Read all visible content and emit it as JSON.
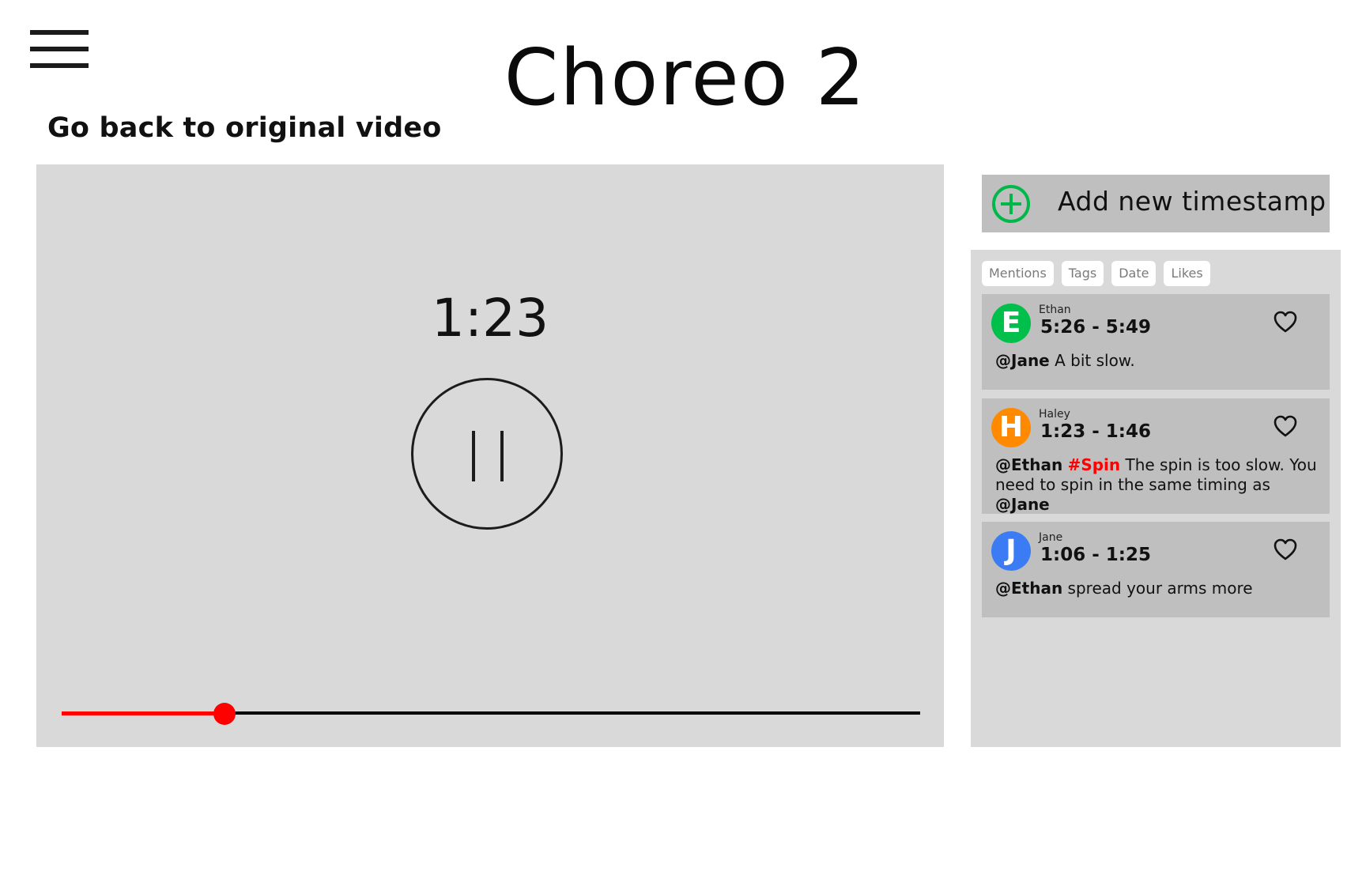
{
  "header": {
    "title": "Choreo 2",
    "back_link": "Go back to original video",
    "menu_icon": "hamburger-menu-icon"
  },
  "player": {
    "current_time": "1:23",
    "state": "playing",
    "control_icon": "pause-icon",
    "progress_fraction": 0.19,
    "colors": {
      "progress": "#ff0000",
      "track": "#000000",
      "background": "#d9d9d9"
    }
  },
  "timestamps": {
    "add_label": "Add new timestamp",
    "add_icon": "plus-circle-icon",
    "add_icon_color": "#00b84a",
    "filters": [
      "Mentions",
      "Tags",
      "Date",
      "Likes"
    ],
    "items": [
      {
        "author": "Ethan",
        "initial": "E",
        "avatar_color": "#00c04b",
        "start": "5:26",
        "end": "5:49",
        "comment": [
          {
            "type": "mention",
            "text": "@Jane"
          },
          {
            "type": "text",
            "text": " A bit slow."
          }
        ]
      },
      {
        "author": "Haley",
        "initial": "H",
        "avatar_color": "#ff8a00",
        "start": "1:23",
        "end": "1:46",
        "comment": [
          {
            "type": "mention",
            "text": "@Ethan"
          },
          {
            "type": "text",
            "text": " "
          },
          {
            "type": "tag",
            "text": "#Spin"
          },
          {
            "type": "text",
            "text": " The spin is too slow. You need to spin in the same timing as "
          },
          {
            "type": "mention",
            "text": "@Jane"
          }
        ]
      },
      {
        "author": "Jane",
        "initial": "J",
        "avatar_color": "#3b7cf5",
        "start": "1:06",
        "end": "1:25",
        "comment": [
          {
            "type": "mention",
            "text": "@Ethan"
          },
          {
            "type": "text",
            "text": " spread your arms more"
          }
        ]
      }
    ]
  }
}
